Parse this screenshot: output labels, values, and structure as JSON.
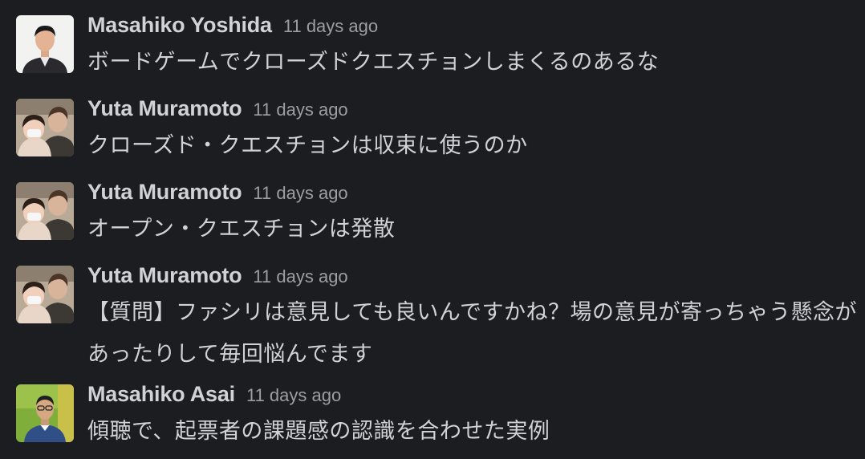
{
  "messages": [
    {
      "author": "Masahiko Yoshida",
      "time": "11 days ago",
      "text": "ボードゲームでクローズドクエスチョンしまくるのあるな",
      "avatar_icon": "avatar-man-suit"
    },
    {
      "author": "Yuta Muramoto",
      "time": "11 days ago",
      "text": "クローズド・クエスチョンは収束に使うのか",
      "avatar_icon": "avatar-man-with-child"
    },
    {
      "author": "Yuta Muramoto",
      "time": "11 days ago",
      "text": "オープン・クエスチョンは発散",
      "avatar_icon": "avatar-man-with-child"
    },
    {
      "author": "Yuta Muramoto",
      "time": "11 days ago",
      "text": "【質問】ファシリは意見しても良いんですかね？場の意見が寄っちゃう懸念があったりして毎回悩んでます",
      "avatar_icon": "avatar-man-with-child"
    },
    {
      "author": "Masahiko Asai",
      "time": "11 days ago",
      "text": "傾聴で、起票者の課題感の認識を合わせた実例",
      "avatar_icon": "avatar-man-glasses-green"
    }
  ],
  "colors": {
    "background": "#1b1d21",
    "text": "#d1d2d3",
    "timestamp": "#9c9ea1"
  }
}
